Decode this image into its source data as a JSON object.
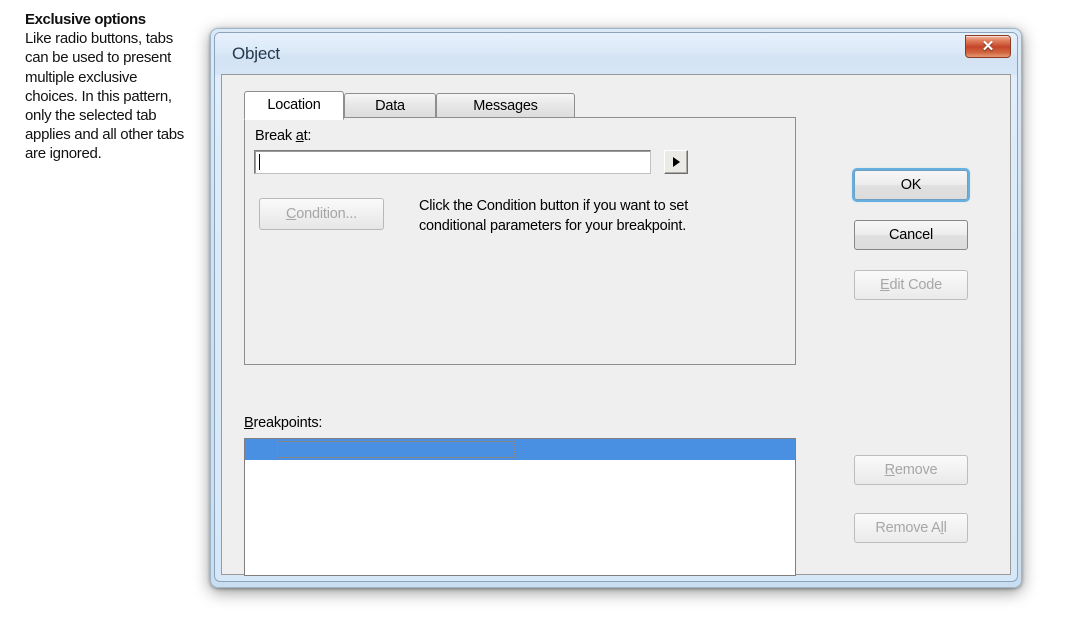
{
  "annotation": {
    "title": "Exclusive options",
    "body": "Like radio buttons, tabs can be used to present multiple exclusive choices. In this pattern, only the selected tab applies and all other tabs are ignored."
  },
  "dialog": {
    "title": "Object",
    "close_icon": "close-icon",
    "close_glyph": "✕",
    "tabs": [
      {
        "label": "Location",
        "selected": true
      },
      {
        "label": "Data",
        "selected": false
      },
      {
        "label": "Messages",
        "selected": false
      }
    ],
    "location_tab": {
      "break_at_label_pre": "Break ",
      "break_at_label_accel": "a",
      "break_at_label_post": "t:",
      "break_at_value": "",
      "break_at_placeholder": "",
      "dropdown_icon": "triangle-right-icon",
      "condition_button": {
        "label_accel": "C",
        "label_post": "ondition...",
        "enabled": false
      },
      "help_text": "Click the Condition button if you want to set conditional parameters for your breakpoint."
    },
    "breakpoints": {
      "label_accel": "B",
      "label_post": "reakpoints:",
      "rows": [
        {
          "text": "",
          "selected": true,
          "focused": true
        }
      ]
    },
    "buttons": {
      "ok": {
        "label": "OK",
        "enabled": true,
        "default": true
      },
      "cancel": {
        "label": "Cancel",
        "enabled": true,
        "default": false
      },
      "edit_code": {
        "label_accel": "E",
        "label_post": "dit Code",
        "enabled": false
      },
      "remove": {
        "label_accel": "R",
        "label_post": "emove",
        "enabled": false
      },
      "remove_all": {
        "label_pre": "Remove A",
        "label_accel": "l",
        "label_post": "l",
        "enabled": false
      }
    }
  },
  "colors": {
    "title_bar": "#d7e6f6",
    "close_button": "#c4452a",
    "selection_blue": "#4a90e2",
    "focus_ring": "#66b0e0",
    "dialog_face": "#efefef",
    "disabled_text": "#a7a7a7"
  }
}
